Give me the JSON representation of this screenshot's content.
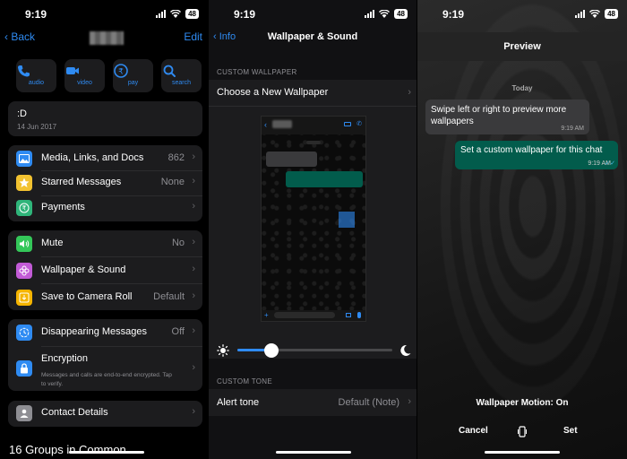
{
  "status": {
    "time": "9:19",
    "battery": "48"
  },
  "panel1": {
    "back": "Back",
    "edit": "Edit",
    "actions": [
      {
        "icon": "phone-icon",
        "label": "audio"
      },
      {
        "icon": "video-icon",
        "label": "video"
      },
      {
        "icon": "rupee-icon",
        "label": "pay"
      },
      {
        "icon": "search-icon",
        "label": "search"
      }
    ],
    "about": {
      "text": ":D",
      "date": "14 Jun 2017"
    },
    "media": {
      "label": "Media, Links, and Docs",
      "value": "862",
      "icon": "photo-icon",
      "color": "#2f8bf2"
    },
    "starred": {
      "label": "Starred Messages",
      "value": "None",
      "icon": "star-icon",
      "color": "#f2c230"
    },
    "payments": {
      "label": "Payments",
      "icon": "rupee-icon",
      "color": "#2fb57a"
    },
    "mute": {
      "label": "Mute",
      "value": "No",
      "icon": "speaker-icon",
      "color": "#34c759"
    },
    "wallpaper": {
      "label": "Wallpaper & Sound",
      "icon": "flower-icon",
      "color": "#c25bd6"
    },
    "camera_roll": {
      "label": "Save to Camera Roll",
      "value": "Default",
      "icon": "download-icon",
      "color": "#f5b400"
    },
    "disappearing": {
      "label": "Disappearing Messages",
      "value": "Off",
      "icon": "timer-icon",
      "color": "#2f8bf2"
    },
    "encryption": {
      "label": "Encryption",
      "sub": "Messages and calls are end-to-end encrypted. Tap to verify.",
      "icon": "lock-icon",
      "color": "#2f8bf2"
    },
    "contact": {
      "label": "Contact Details",
      "icon": "person-icon",
      "color": "#8e8e93"
    },
    "groups": "16 Groups in Common"
  },
  "panel2": {
    "back": "Info",
    "title": "Wallpaper & Sound",
    "custom_wallpaper_header": "CUSTOM WALLPAPER",
    "choose": "Choose a New Wallpaper",
    "brightness_level": 0.22,
    "custom_tone_header": "CUSTOM TONE",
    "alert_label": "Alert tone",
    "alert_value": "Default (Note)",
    "icons": {
      "dim": "sun-icon",
      "dark": "moon-icon"
    }
  },
  "panel3": {
    "title": "Preview",
    "today": "Today",
    "incoming": {
      "text": "Swipe left or right to preview more wallpapers",
      "time": "9:19 AM"
    },
    "outgoing": {
      "text": "Set a custom wallpaper for this chat",
      "time": "9:19 AM"
    },
    "motion": "Wallpaper Motion: On",
    "cancel": "Cancel",
    "set": "Set",
    "motion_icon": "motion-phone-icon"
  },
  "colors": {
    "accent": "#2f8bf2",
    "outgoing_bubble": "#025c4c",
    "incoming_bubble": "#3a3a3c"
  }
}
